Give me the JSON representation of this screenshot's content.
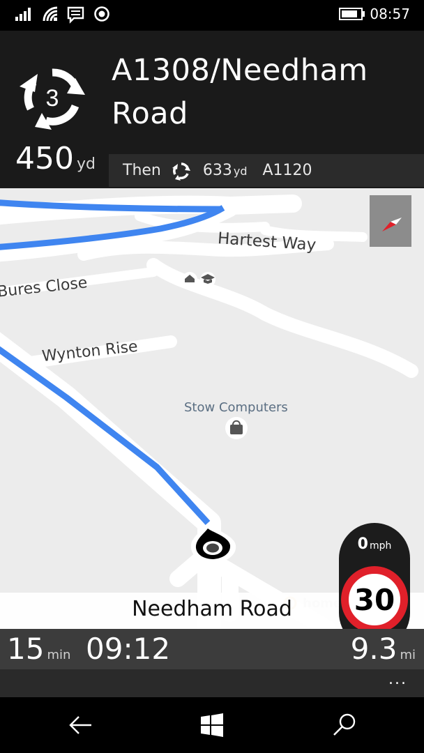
{
  "status_bar": {
    "time": "08:57",
    "icons": [
      "signal-icon",
      "wifi-icon",
      "message-icon",
      "location-icon",
      "battery-icon"
    ]
  },
  "instruction": {
    "roundabout_exit": "3",
    "street": "A1308/Needham Road",
    "distance_value": "450",
    "distance_unit": "yd",
    "then_label": "Then",
    "then_distance": "633",
    "then_unit": "yd",
    "then_road": "A1120"
  },
  "map": {
    "labels": {
      "hartest_way": "Hartest Way",
      "bures_close": "Bures Close",
      "wynton_rise": "Wynton Rise",
      "stow_computers": "Stow Computers",
      "home": "home"
    },
    "current_street": "Needham Road",
    "route_color": "#3f85f0"
  },
  "speed": {
    "current_value": "0",
    "current_unit": "mph",
    "limit": "30"
  },
  "trip": {
    "duration_value": "15",
    "duration_unit": "min",
    "arrival_time": "09:12",
    "distance_value": "9.3",
    "distance_unit": "mi"
  },
  "app_bar": {
    "more_label": "..."
  },
  "nav_bar": {
    "buttons": [
      "back-icon",
      "windows-start-icon",
      "search-icon"
    ]
  }
}
